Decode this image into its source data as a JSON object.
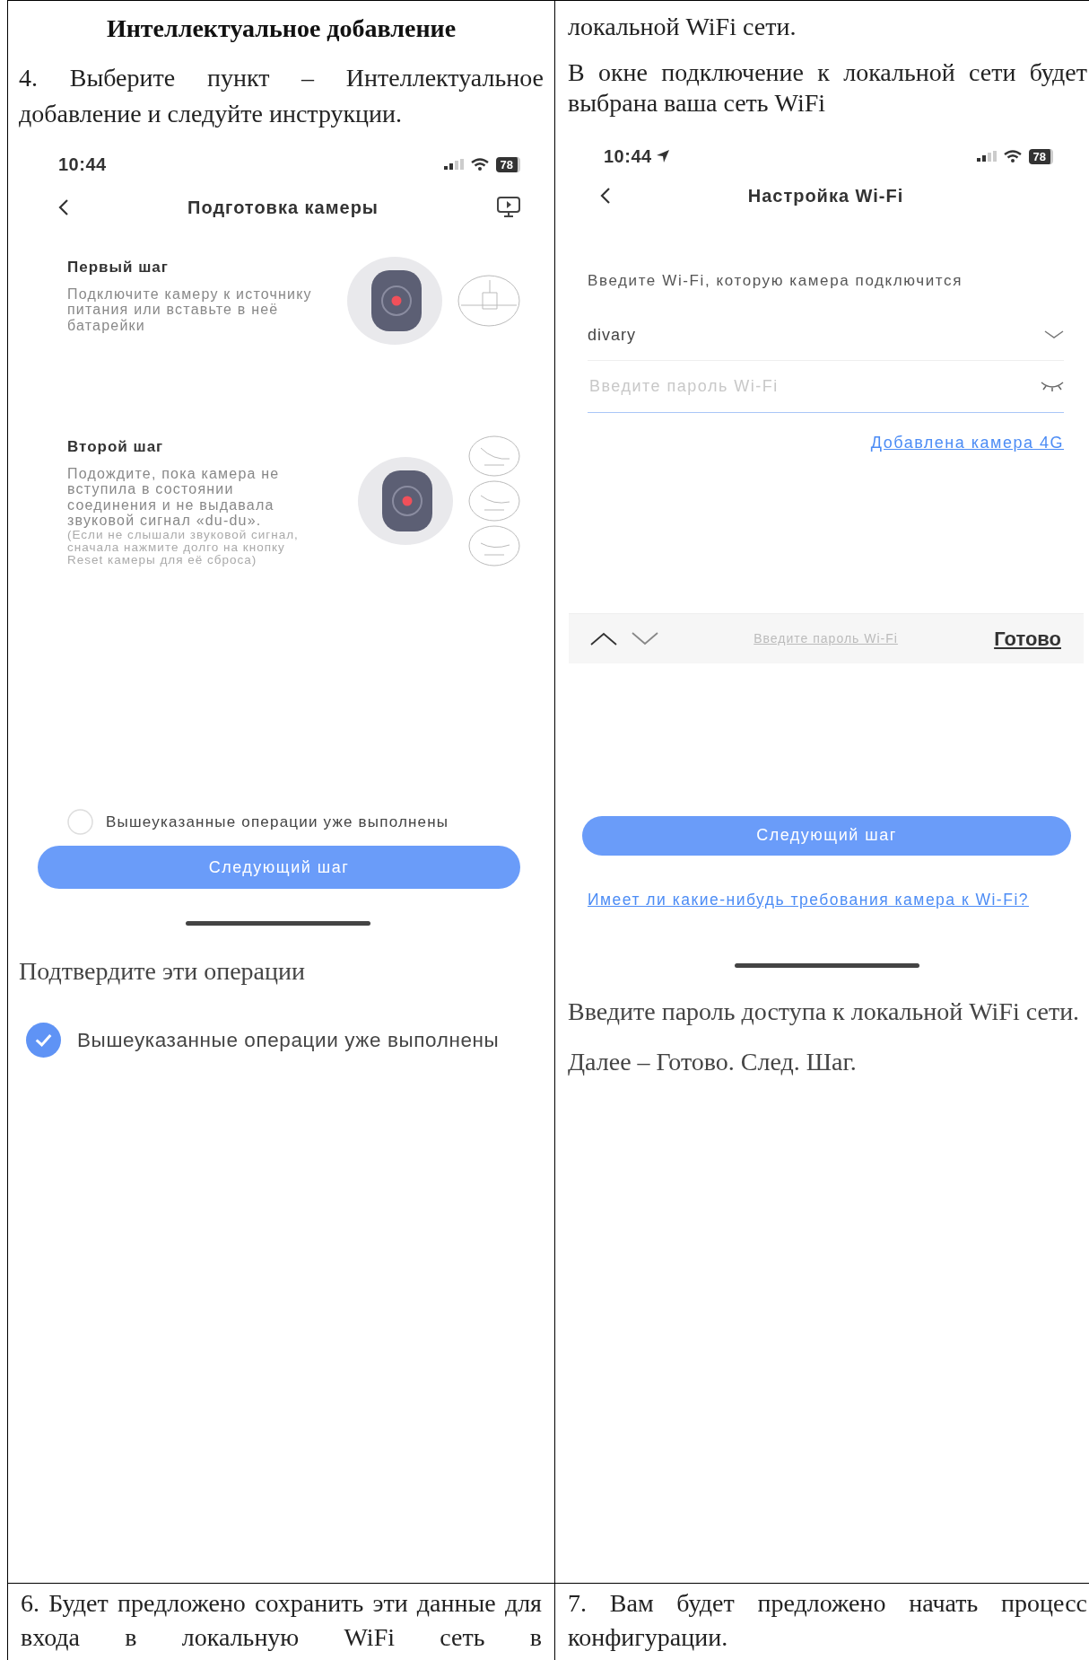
{
  "left_column": {
    "heading": "Интеллектуальное добавление",
    "paragraph": "4. Выберите пункт – Интеллектуальное добавление и следуйте инструкции.",
    "phone": {
      "status_time": "10:44",
      "battery": "78",
      "title": "Подготовка камеры",
      "steps": [
        {
          "title": "Первый шаг",
          "text": "Подключите камеру к источнику питания или вставьте в неё батарейки",
          "kind": "power"
        },
        {
          "title": "Второй шаг",
          "text": "Подождите, пока камера не вступила в состоянии соединения и не выдавала звуковой сигнал «du-du».",
          "note": "(Если не слышали звуковой сигнал, сначала нажмите долго на кнопку Reset камеры для её сброса)",
          "kind": "reset"
        }
      ],
      "confirm": {
        "label": "Вышеуказанные операции уже выполнены",
        "checked": false
      },
      "button": "Следующий шаг"
    },
    "caption": "Подтвердите эти операции",
    "confirm_closeup": {
      "label": "Вышеуказанные операции уже выполнены",
      "checked": true
    }
  },
  "right_column": {
    "text_top": "локальной WiFi сети.",
    "paragraph": "В окне подключение к локальной сети будет выбрана ваша сеть WiFi",
    "phone": {
      "status_time": "10:44",
      "battery": "78",
      "title": "Настройка Wi-Fi",
      "prompt": "Введите Wi-Fi, которую камера подключится",
      "network": "divary",
      "password": {
        "placeholder": "Введите пароль Wi-Fi"
      },
      "link_4g": "Добавлена камера 4G",
      "keyboard_bar": {
        "hint": "Введите пароль Wi-Fi",
        "done": "Готово"
      },
      "button": "Следующий шаг",
      "link_requirements": "Имеет ли какие-нибудь требования камера к Wi-Fi?"
    },
    "captions": [
      "Введите пароль доступа к локальной WiFi сети.",
      "Далее – Готово. След. Шаг."
    ]
  },
  "bottom_row": [
    "6. Будет предложено сохранить эти данные для входа в локальную WiFi сеть в",
    "7. Вам будет предложено начать процесс конфигурации."
  ]
}
